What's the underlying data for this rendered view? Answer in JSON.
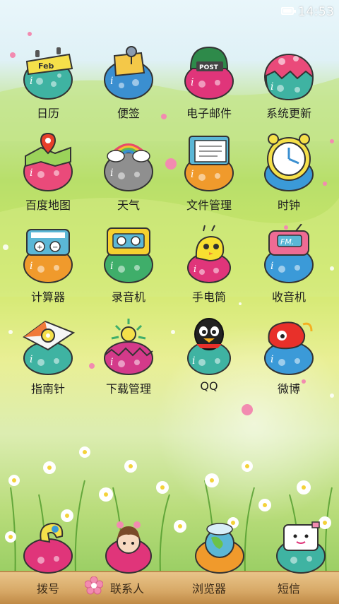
{
  "status_bar": {
    "time": "14:53",
    "battery_icon": "battery-icon"
  },
  "apps": [
    {
      "label": "日历",
      "icon": "calendar-icon",
      "egg": "#3fb3a2",
      "badge": "Feb"
    },
    {
      "label": "便签",
      "icon": "notes-pin-icon",
      "egg": "#3b8fd0"
    },
    {
      "label": "电子邮件",
      "icon": "email-postbox-icon",
      "egg": "#e0357a",
      "badge": "POST"
    },
    {
      "label": "系统更新",
      "icon": "system-update-icon",
      "egg": "#ea4a7a"
    },
    {
      "label": "百度地图",
      "icon": "map-pin-icon",
      "egg": "#ea4a7a"
    },
    {
      "label": "天气",
      "icon": "rainbow-cloud-icon",
      "egg": "#8f8f8f"
    },
    {
      "label": "文件管理",
      "icon": "folder-files-icon",
      "egg": "#f09a2c"
    },
    {
      "label": "时钟",
      "icon": "alarm-clock-icon",
      "egg": "#3b9ad8"
    },
    {
      "label": "计算器",
      "icon": "calculator-icon",
      "egg": "#f09a2c"
    },
    {
      "label": "录音机",
      "icon": "tape-recorder-icon",
      "egg": "#3fae6a"
    },
    {
      "label": "手电筒",
      "icon": "flashlight-chick-icon",
      "egg": "#e0357a"
    },
    {
      "label": "收音机",
      "icon": "fm-radio-icon",
      "egg": "#3b9ad8",
      "badge": "FM."
    },
    {
      "label": "指南针",
      "icon": "compass-icon",
      "egg": "#3fb3a2"
    },
    {
      "label": "下载管理",
      "icon": "download-flower-icon",
      "egg": "#d43a8a"
    },
    {
      "label": "QQ",
      "icon": "qq-penguin-icon",
      "egg": "#3fb3a2"
    },
    {
      "label": "微博",
      "icon": "weibo-icon",
      "egg": "#3b9ad8"
    }
  ],
  "dock": [
    {
      "label": "拨号",
      "icon": "phone-icon",
      "egg": "#e0357a"
    },
    {
      "label": "联系人",
      "icon": "contacts-girl-icon",
      "egg": "#e0357a"
    },
    {
      "label": "浏览器",
      "icon": "browser-globe-icon",
      "egg": "#f09a2c"
    },
    {
      "label": "短信",
      "icon": "sms-message-icon",
      "egg": "#3fb3a2"
    }
  ]
}
